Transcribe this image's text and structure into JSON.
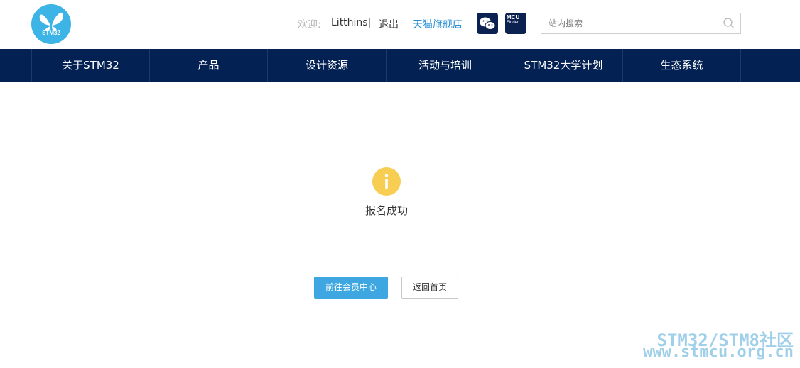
{
  "header": {
    "logo_text": "STM32",
    "welcome_label": "欢迎:",
    "username": "Litthins",
    "separator": "|",
    "logout_label": "退出",
    "tmall_label": "天猫旗舰店",
    "mcu_badge_line1": "MCU",
    "mcu_badge_line2": "Finder",
    "search_placeholder": "站内搜索"
  },
  "nav": {
    "items": [
      {
        "label": "关于STM32"
      },
      {
        "label": "产品"
      },
      {
        "label": "设计资源"
      },
      {
        "label": "活动与培训"
      },
      {
        "label": "STM32大学计划"
      },
      {
        "label": "生态系统"
      }
    ]
  },
  "main": {
    "status_text": "报名成功",
    "primary_button": "前往会员中心",
    "secondary_button": "返回首页"
  },
  "watermark": {
    "line1": "STM32/STM8社区",
    "line2": "www.stmcu.org.cn"
  },
  "colors": {
    "nav_bg": "#032152",
    "accent": "#3ea7e2",
    "logo": "#3cb4e5",
    "info_icon": "#f7ce52",
    "link": "#2a8fd4"
  }
}
